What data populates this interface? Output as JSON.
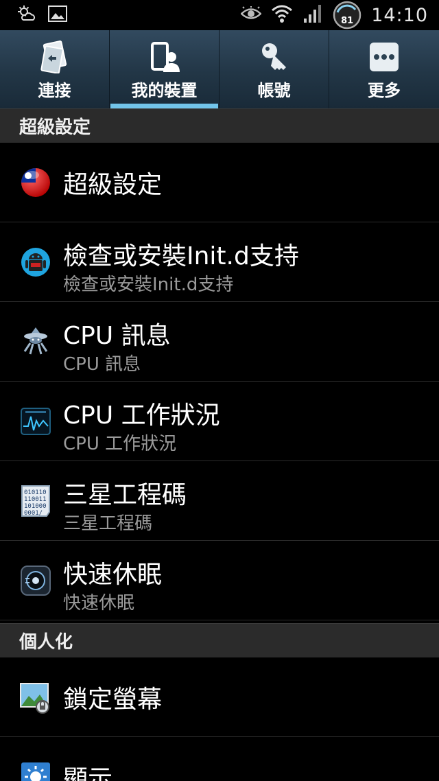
{
  "status_bar": {
    "time": "14:10",
    "battery_level": "81",
    "icons": [
      "weather-icon",
      "image-notification-icon",
      "eye-icon",
      "wifi-icon",
      "signal-icon",
      "battery-icon"
    ]
  },
  "tabs": [
    {
      "label": "連接",
      "icon": "connections-icon",
      "active": false
    },
    {
      "label": "我的裝置",
      "icon": "my-device-icon",
      "active": true
    },
    {
      "label": "帳號",
      "icon": "key-icon",
      "active": false
    },
    {
      "label": "更多",
      "icon": "more-icon",
      "active": false
    }
  ],
  "sections": [
    {
      "header": "超級設定",
      "items": [
        {
          "title": "超級設定",
          "subtitle": "",
          "icon": "taiwan-flag-icon"
        },
        {
          "title": "檢查或安裝Init.d支持",
          "subtitle": "檢查或安裝Init.d支持",
          "icon": "android-robot-icon"
        },
        {
          "title": "CPU 訊息",
          "subtitle": "CPU 訊息",
          "icon": "cpu-info-icon"
        },
        {
          "title": "CPU 工作狀況",
          "subtitle": "CPU 工作狀況",
          "icon": "cpu-monitor-icon"
        },
        {
          "title": "三星工程碼",
          "subtitle": "三星工程碼",
          "icon": "binary-code-icon"
        },
        {
          "title": "快速休眠",
          "subtitle": "快速休眠",
          "icon": "quick-sleep-icon"
        }
      ]
    },
    {
      "header": "個人化",
      "items": [
        {
          "title": "鎖定螢幕",
          "subtitle": "",
          "icon": "lock-screen-icon"
        },
        {
          "title": "顯示",
          "subtitle": "",
          "icon": "display-icon"
        }
      ]
    }
  ],
  "colors": {
    "tab_bar": "#223646",
    "tab_indicator": "#72c4ea",
    "section_header": "#2b2b2b",
    "subtitle": "#9a9a9a"
  }
}
